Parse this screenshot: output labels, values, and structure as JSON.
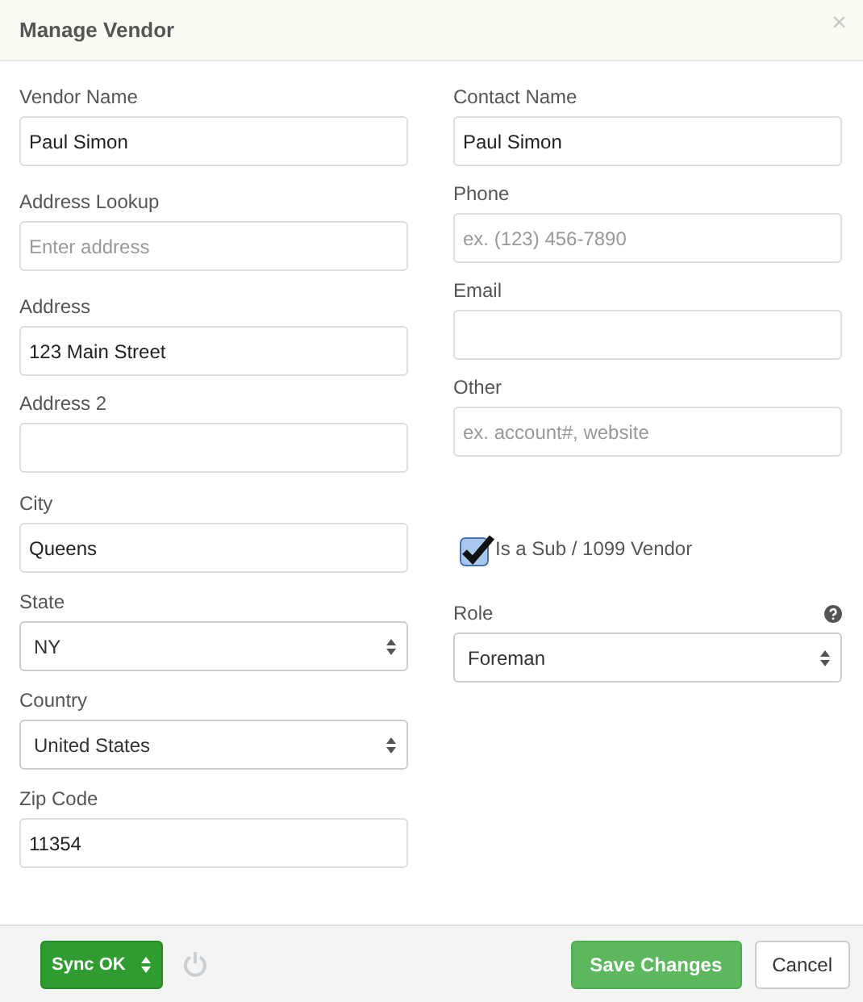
{
  "dialog": {
    "title": "Manage Vendor",
    "close": "×"
  },
  "left_fields": [
    {
      "kind": "text",
      "label": "Vendor Name",
      "value": "Paul Simon"
    },
    {
      "kind": "text",
      "label": "Address Lookup",
      "placeholder": "Enter address"
    },
    {
      "kind": "text",
      "label": "Address",
      "value": "123 Main Street"
    },
    {
      "kind": "text",
      "label": "Address 2"
    },
    {
      "kind": "text",
      "label": "City",
      "value": "Queens"
    },
    {
      "kind": "select",
      "label": "State",
      "value": "NY"
    },
    {
      "kind": "select",
      "label": "Country",
      "value": "United States"
    },
    {
      "kind": "text",
      "label": "Zip Code",
      "value": "11354"
    }
  ],
  "right_fields": [
    {
      "kind": "text",
      "label": "Contact Name",
      "value": "Paul Simon"
    },
    {
      "kind": "text",
      "label": "Phone",
      "placeholder": "ex. (123) 456-7890"
    },
    {
      "kind": "text",
      "label": "Email"
    },
    {
      "kind": "text",
      "label": "Other",
      "placeholder": "ex. account#, website"
    },
    {
      "kind": "checkbox",
      "label": "Is a Sub / 1099 Vendor",
      "checked": true
    },
    {
      "kind": "select",
      "label": "Role",
      "value": "Foreman",
      "has_help": true
    }
  ],
  "footer": {
    "sync_status": "Sync OK",
    "save": "Save Changes",
    "cancel": "Cancel"
  }
}
